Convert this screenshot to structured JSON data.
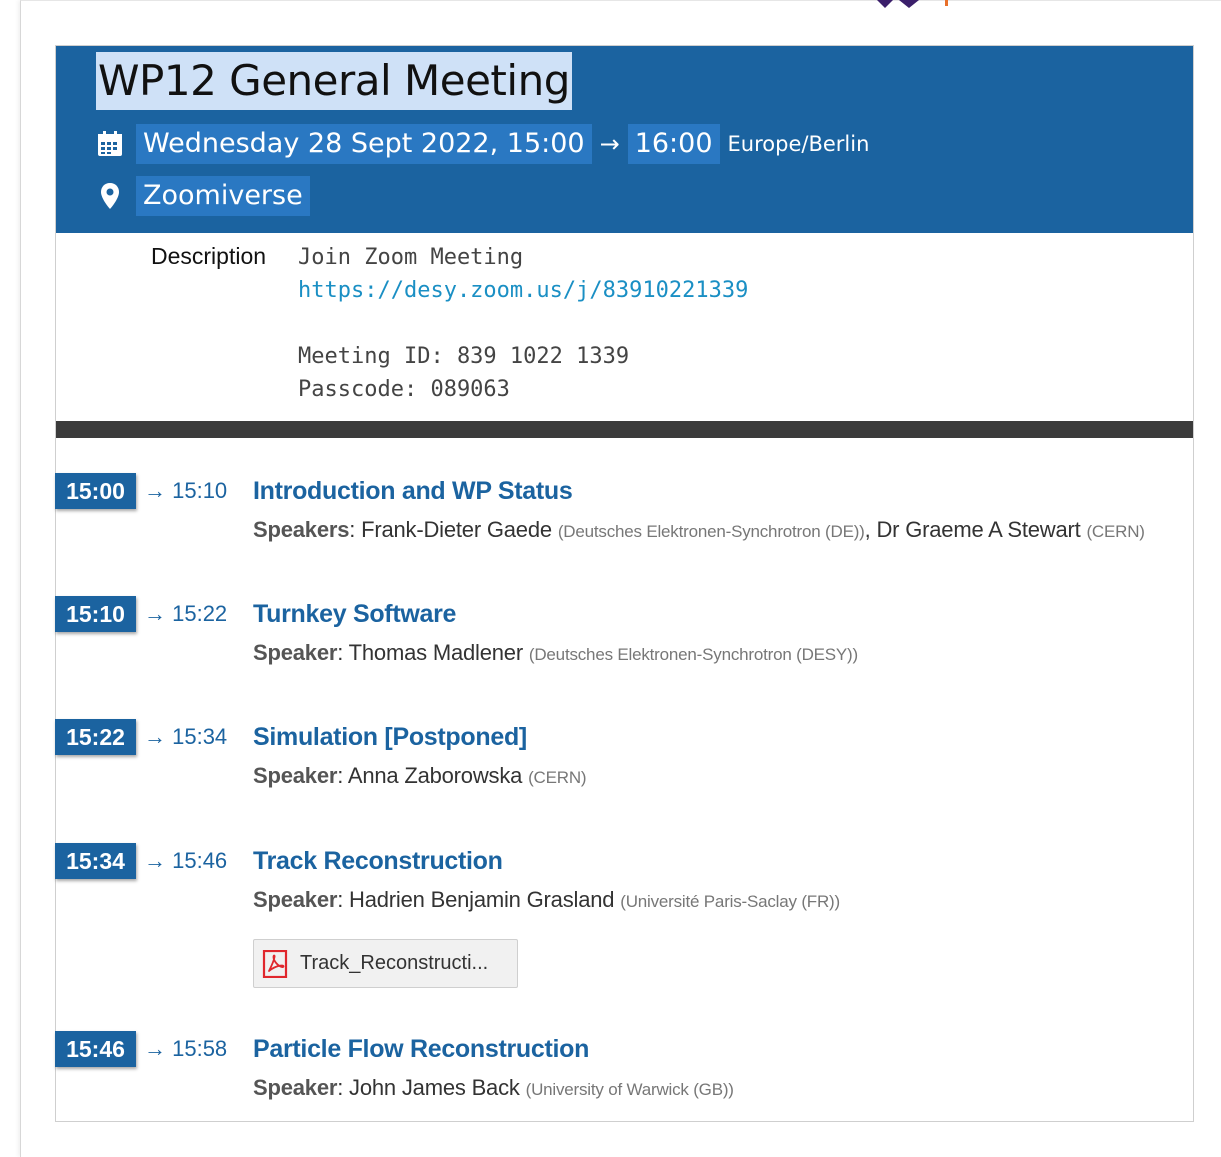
{
  "colors": {
    "header_bg": "#1b63a0",
    "highlight": "#2a78c2",
    "title_selection": "#cfe1f7",
    "link": "#1a8fc4",
    "divider": "#3b3b3b",
    "pdf_red": "#e0272d"
  },
  "header": {
    "title": "WP12 General Meeting",
    "date_icon": "calendar-icon",
    "date_start": "Wednesday 28 Sept 2022, 15:00",
    "arrow": "→",
    "date_end": "16:00",
    "timezone": "Europe/Berlin",
    "location_icon": "map-pin-icon",
    "location": "Zoomiverse"
  },
  "description": {
    "label": "Description",
    "join_text": "Join Zoom Meeting",
    "zoom_link": "https://desy.zoom.us/j/83910221339",
    "meeting_id": "Meeting ID: 839 1022 1339",
    "passcode": "Passcode: 089063"
  },
  "timetable": [
    {
      "start": "15:00",
      "end": "→ 15:10",
      "title": "Introduction and WP Status",
      "speaker_label": "Speakers",
      "speakers_html_parts": [
        {
          "name": "Frank-Dieter Gaede",
          "affiliation": "(Deutsches Elektronen-Synchrotron (DE))"
        },
        {
          "name": "Dr Graeme A Stewart",
          "affiliation": "(CERN)"
        }
      ]
    },
    {
      "start": "15:10",
      "end": "→ 15:22",
      "title": "Turnkey Software",
      "speaker_label": "Speaker",
      "speakers_html_parts": [
        {
          "name": "Thomas Madlener",
          "affiliation": "(Deutsches Elektronen-Synchrotron (DESY))"
        }
      ]
    },
    {
      "start": "15:22",
      "end": "→ 15:34",
      "title": "Simulation [Postponed]",
      "speaker_label": "Speaker",
      "speakers_html_parts": [
        {
          "name": "Anna Zaborowska",
          "affiliation": "(CERN)"
        }
      ]
    },
    {
      "start": "15:34",
      "end": "→ 15:46",
      "title": "Track Reconstruction",
      "speaker_label": "Speaker",
      "speakers_html_parts": [
        {
          "name": "Hadrien Benjamin Grasland",
          "affiliation": "(Université Paris-Saclay (FR))"
        }
      ],
      "attachment": {
        "icon": "pdf-icon",
        "label": "Track_Reconstructi..."
      }
    },
    {
      "start": "15:46",
      "end": "→ 15:58",
      "title": "Particle Flow Reconstruction",
      "speaker_label": "Speaker",
      "speakers_html_parts": [
        {
          "name": "John James Back",
          "affiliation": "(University of Warwick (GB))"
        }
      ]
    }
  ]
}
